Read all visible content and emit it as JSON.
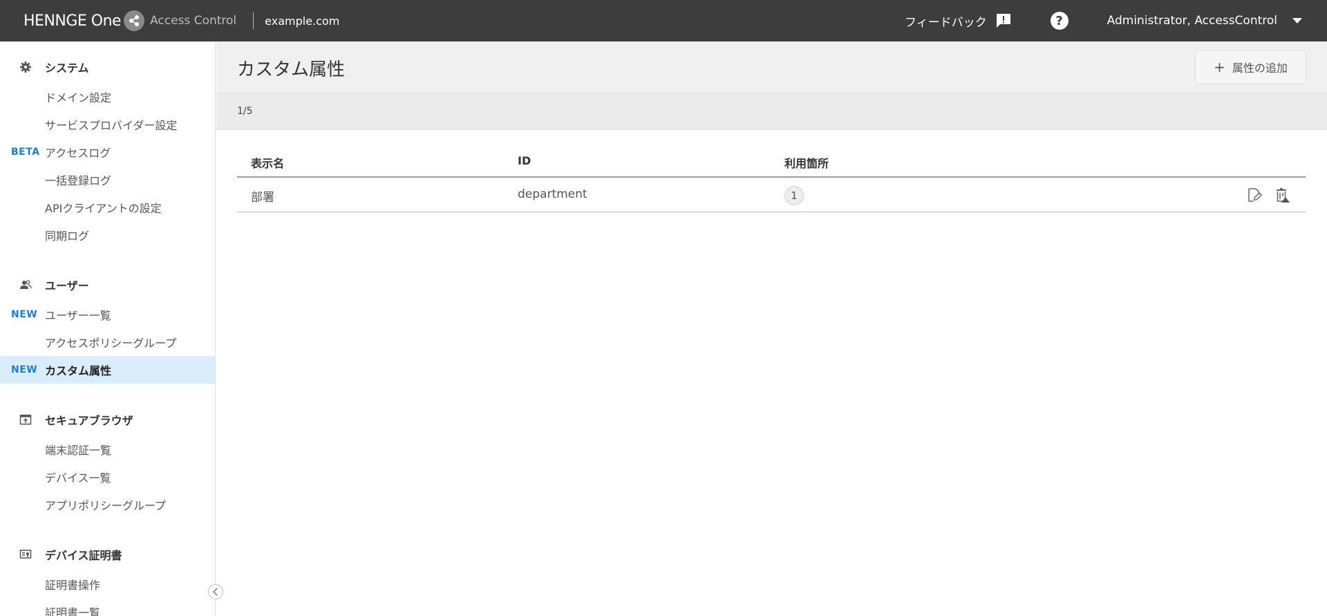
{
  "header": {
    "brand": "HENNGE One",
    "product": "Access Control",
    "domain": "example.com",
    "feedback_label": "フィードバック",
    "help_label": "?",
    "user_name": "Administrator, AccessControl"
  },
  "sidebar": {
    "sections": [
      {
        "label": "システム",
        "icon": "gear-icon"
      },
      {
        "label": "ユーザー",
        "icon": "users-icon"
      },
      {
        "label": "セキュアブラウザ",
        "icon": "browser-icon"
      },
      {
        "label": "デバイス証明書",
        "icon": "certificate-icon"
      }
    ],
    "items": [
      {
        "label": "ドメイン設定",
        "badge": ""
      },
      {
        "label": "サービスプロバイダー設定",
        "badge": ""
      },
      {
        "label": "アクセスログ",
        "badge": "BETA"
      },
      {
        "label": "一括登録ログ",
        "badge": ""
      },
      {
        "label": "APIクライアントの設定",
        "badge": ""
      },
      {
        "label": "同期ログ",
        "badge": ""
      },
      {
        "label": "ユーザー一覧",
        "badge": "NEW"
      },
      {
        "label": "アクセスポリシーグループ",
        "badge": ""
      },
      {
        "label": "カスタム属性",
        "badge": "NEW",
        "active": true
      },
      {
        "label": "端末認証一覧",
        "badge": ""
      },
      {
        "label": "デバイス一覧",
        "badge": ""
      },
      {
        "label": "アプリポリシーグループ",
        "badge": ""
      },
      {
        "label": "証明書操作",
        "badge": ""
      },
      {
        "label": "証明書一覧",
        "badge": ""
      }
    ]
  },
  "main": {
    "title": "カスタム属性",
    "add_button_label": "属性の追加",
    "pager": "1/5",
    "table": {
      "columns": [
        "表示名",
        "ID",
        "利用箇所"
      ],
      "rows": [
        {
          "display_name": "部署",
          "id": "department",
          "usage": "1"
        }
      ]
    }
  },
  "colors": {
    "topbar": "#3d3d3d",
    "accent": "#1c7ed6",
    "active_bg": "#daedfb"
  }
}
